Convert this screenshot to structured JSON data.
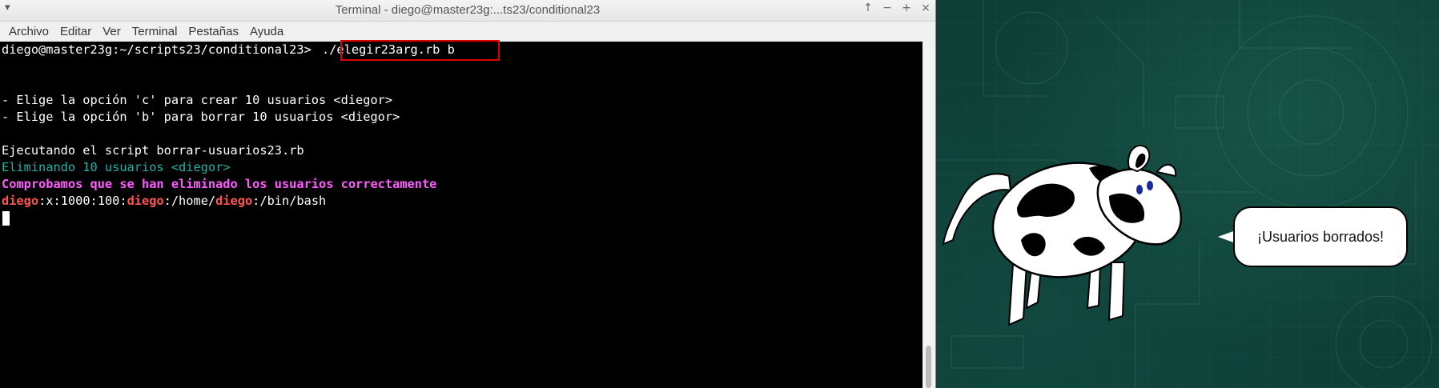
{
  "window": {
    "title": "Terminal - diego@master23g:...ts23/conditional23",
    "menu_glyph": "▾",
    "controls": {
      "up": "↑",
      "minimize": "−",
      "maximize": "+",
      "close": "×"
    }
  },
  "menubar": [
    "Archivo",
    "Editar",
    "Ver",
    "Terminal",
    "Pestañas",
    "Ayuda"
  ],
  "terminal": {
    "prompt": "diego@master23g:~/scripts23/conditional23> ",
    "command": "./elegir23arg.rb b",
    "option_c": "- Elige la opción 'c' para crear 10 usuarios <diegor>",
    "option_b": "- Elige la opción 'b' para borrar 10 usuarios <diegor>",
    "executing": "Ejecutando el script borrar-usuarios23.rb",
    "deleting": "Eliminando 10 usuarios <diegor>",
    "verify": "Comprobamos que se han eliminado los usuarios correctamente",
    "passwd_line": {
      "user1": "diego",
      "part1": ":x:1000:100:",
      "user2": "diego",
      "part2": ":/home/",
      "user3": "diego",
      "part3": ":/bin/bash"
    }
  },
  "cowsay": {
    "message": "¡Usuarios borrados!"
  },
  "colors": {
    "highlight_box": "#e00000",
    "teal_text": "#1eb2a8",
    "magenta_text": "#ff5cff",
    "red_text": "#ff5454",
    "desktop": "#0e3f37"
  }
}
